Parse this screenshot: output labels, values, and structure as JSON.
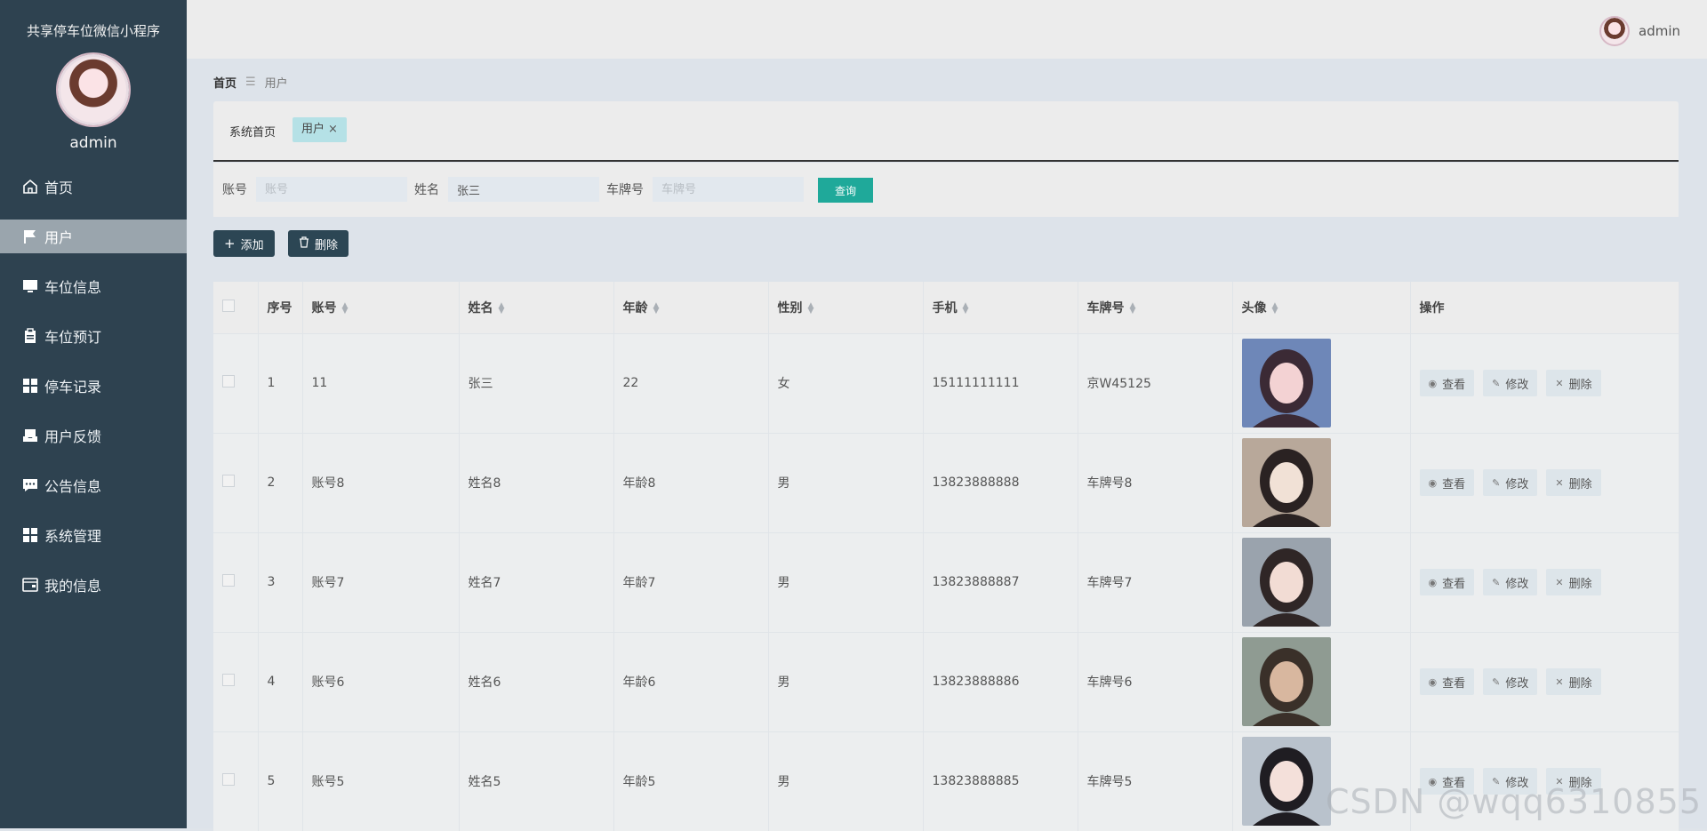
{
  "sidebar": {
    "app_title": "共享停车位微信小程序",
    "user_name": "admin",
    "items": [
      {
        "label": "首页",
        "icon": "home-icon"
      },
      {
        "label": "用户",
        "icon": "flag-icon"
      },
      {
        "label": "车位信息",
        "icon": "monitor-icon"
      },
      {
        "label": "车位预订",
        "icon": "clipboard-icon"
      },
      {
        "label": "停车记录",
        "icon": "grid-icon"
      },
      {
        "label": "用户反馈",
        "icon": "tray-icon"
      },
      {
        "label": "公告信息",
        "icon": "chat-icon"
      },
      {
        "label": "系统管理",
        "icon": "grid-icon"
      },
      {
        "label": "我的信息",
        "icon": "id-card-icon"
      }
    ],
    "active_index": 1
  },
  "topbar": {
    "user_name": "admin"
  },
  "breadcrumb": {
    "home": "首页",
    "current": "用户"
  },
  "tabs": {
    "home": "系统首页",
    "active": "用户",
    "close": "×"
  },
  "search": {
    "account_label": "账号",
    "account_placeholder": "账号",
    "account_value": "",
    "name_label": "姓名",
    "name_placeholder": "姓名",
    "name_value": "张三",
    "plate_label": "车牌号",
    "plate_placeholder": "车牌号",
    "plate_value": "",
    "button_label": "查询"
  },
  "actions": {
    "add_label": "添加",
    "delete_label": "删除"
  },
  "table": {
    "columns": [
      "序号",
      "账号",
      "姓名",
      "年龄",
      "性别",
      "手机",
      "车牌号",
      "头像",
      "操作"
    ],
    "rows": [
      {
        "index": "1",
        "account": "11",
        "name": "张三",
        "age": "22",
        "gender": "女",
        "phone": "15111111111",
        "plate": "京W45125"
      },
      {
        "index": "2",
        "account": "账号8",
        "name": "姓名8",
        "age": "年龄8",
        "gender": "男",
        "phone": "13823888888",
        "plate": "车牌号8"
      },
      {
        "index": "3",
        "account": "账号7",
        "name": "姓名7",
        "age": "年龄7",
        "gender": "男",
        "phone": "13823888887",
        "plate": "车牌号7"
      },
      {
        "index": "4",
        "account": "账号6",
        "name": "姓名6",
        "age": "年龄6",
        "gender": "男",
        "phone": "13823888886",
        "plate": "车牌号6"
      },
      {
        "index": "5",
        "account": "账号5",
        "name": "姓名5",
        "age": "年龄5",
        "gender": "男",
        "phone": "13823888885",
        "plate": "车牌号5"
      }
    ],
    "ops": {
      "view": "查看",
      "edit": "修改",
      "delete": "删除"
    }
  },
  "watermark": "CSDN @wqq6310855"
}
